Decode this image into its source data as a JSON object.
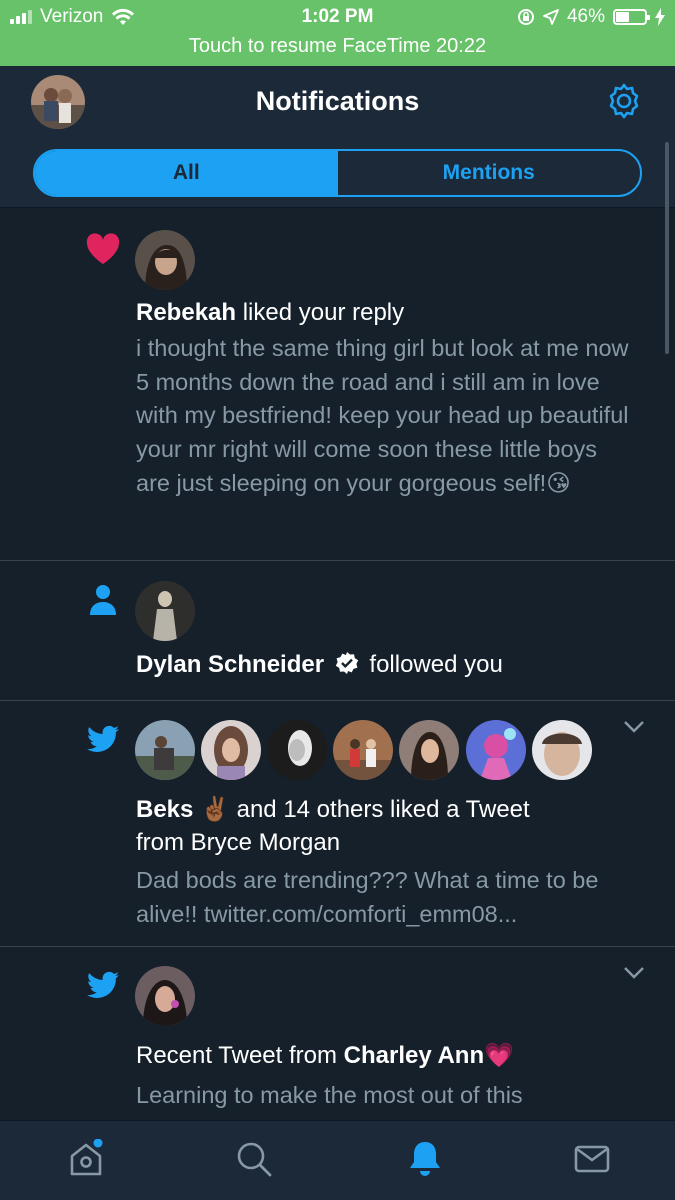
{
  "status_bar": {
    "carrier": "Verizon",
    "time": "1:02 PM",
    "battery": "46%",
    "battery_level": 0.46,
    "facetime_banner": "Touch to resume FaceTime 20:22"
  },
  "header": {
    "title": "Notifications",
    "tabs": [
      {
        "label": "All",
        "active": true
      },
      {
        "label": "Mentions",
        "active": false
      }
    ]
  },
  "notifications": [
    {
      "icon": "heart-icon",
      "user": "Rebekah",
      "action": " liked your reply",
      "text": "i thought the same thing girl but look at me now 5 months down the road and i still am in love with my bestfriend! keep your head up beautiful your mr right will come soon these little boys are just sleeping on your gorgeous self!😘"
    },
    {
      "icon": "person-icon",
      "user": "Dylan Schneider",
      "verified": true,
      "action": "followed you"
    },
    {
      "icon": "twitter-bird-icon",
      "user": "Beks ✌🏾",
      "action_line1": " and 14 others liked a Tweet",
      "action_line2": "from Bryce Morgan",
      "text": "Dad bods are trending??? What a time to be alive!! twitter.com/comforti_emm08..."
    },
    {
      "icon": "twitter-bird-icon",
      "prefix": "Recent Tweet from ",
      "user": "Charley Ann💗",
      "text": "Learning to make the most out of this"
    }
  ],
  "tab_bar": [
    {
      "name": "home-icon",
      "active": false,
      "badge": true
    },
    {
      "name": "search-icon",
      "active": false
    },
    {
      "name": "notifications-bell-icon",
      "active": true
    },
    {
      "name": "messages-mail-icon",
      "active": false
    }
  ],
  "colors": {
    "background": "#15202b",
    "header": "#1c2938",
    "accent": "#1da1f2",
    "heart": "#e0245e",
    "muted_text": "#8899a6",
    "status_bar": "#68c26a"
  }
}
